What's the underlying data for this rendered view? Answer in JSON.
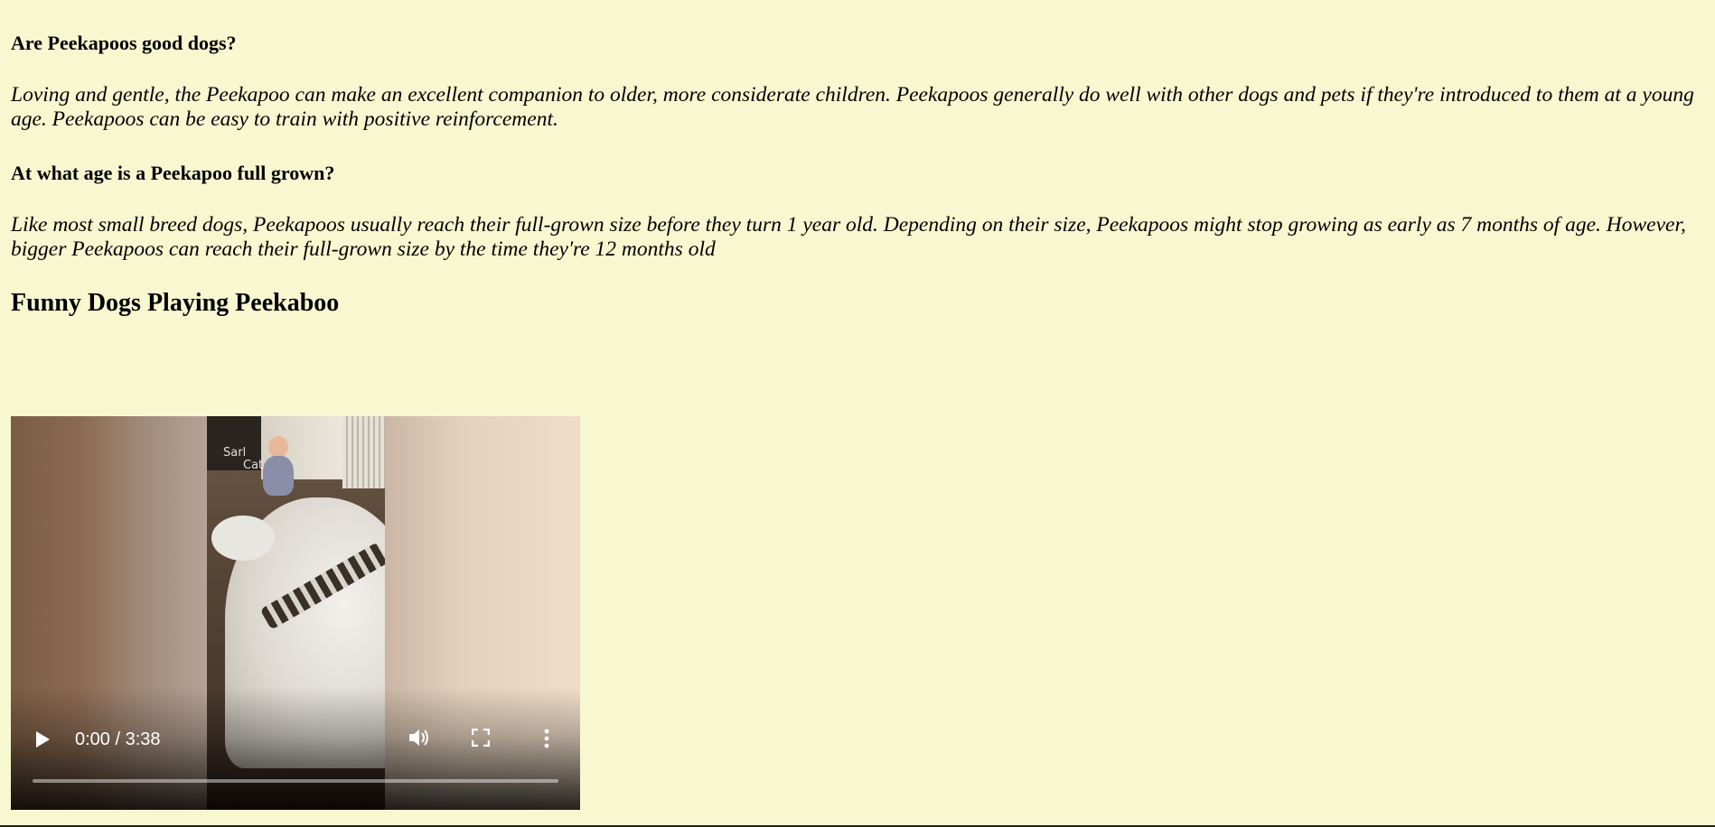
{
  "faq": [
    {
      "question": "Are Peekapoos good dogs?",
      "answer": "Loving and gentle, the Peekapoo can make an excellent companion to older, more considerate children. Peekapoos generally do well with other dogs and pets if they're introduced to them at a young age. Peekapoos can be easy to train with positive reinforcement."
    },
    {
      "question": "At what age is a Peekapoo full grown?",
      "answer": "Like most small breed dogs, Peekapoos usually reach their full-grown size before they turn 1 year old. Depending on their size, Peekapoos might stop growing as early as 7 months of age. However, bigger Peekapoos can reach their full-grown size by the time they're 12 months old"
    }
  ],
  "video": {
    "title": "Funny Dogs Playing Peekaboo",
    "time_display": "0:00 / 3:38",
    "progress": 0,
    "watermark_line1": "Sarl",
    "watermark_line2": "Cat",
    "icons": {
      "play": "play-icon",
      "volume": "volume-icon",
      "fullscreen": "fullscreen-icon",
      "menu": "more-options-icon"
    }
  },
  "colors": {
    "background": "#f8f8d0"
  }
}
